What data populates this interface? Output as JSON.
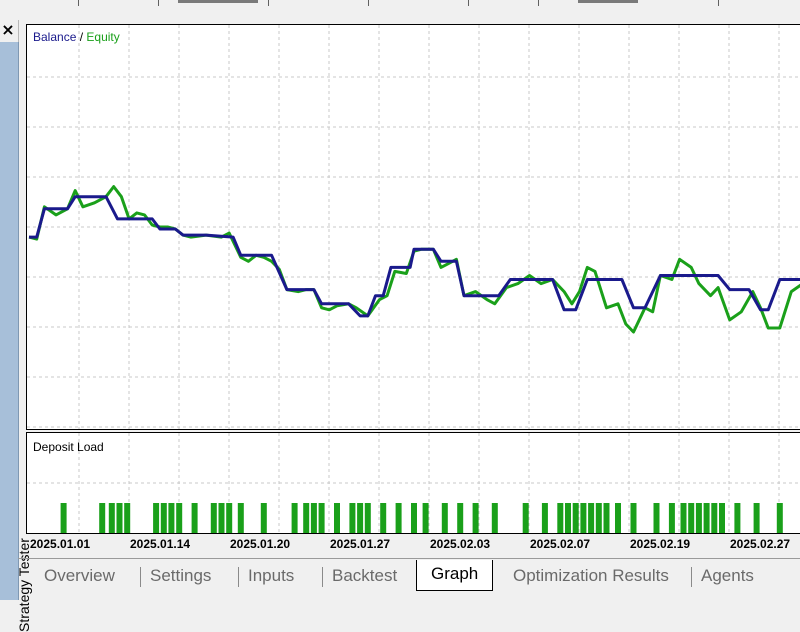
{
  "panel": {
    "title": "Strategy Tester",
    "close_glyph": "×",
    "close_icon": "close-icon"
  },
  "main_chart": {
    "legend_balance": "Balance",
    "legend_separator": "/",
    "legend_equity": "Equity"
  },
  "deposit_chart": {
    "label": "Deposit Load"
  },
  "tabs": [
    {
      "label": "Overview",
      "active": false
    },
    {
      "label": "Settings",
      "active": false
    },
    {
      "label": "Inputs",
      "active": false
    },
    {
      "label": "Backtest",
      "active": false
    },
    {
      "label": "Graph",
      "active": true
    },
    {
      "label": "Optimization Results",
      "active": false
    },
    {
      "label": "Agents",
      "active": false
    }
  ],
  "colors": {
    "balance": "#1a1a8c",
    "equity": "#1aa01a",
    "deposit_bar": "#1aa01a",
    "grid": "#c8c8c8"
  },
  "chart_data": {
    "type": "line",
    "title": "",
    "x_tick_labels": [
      "2025.01.01",
      "2025.01.14",
      "2025.01.20",
      "2025.01.27",
      "2025.02.03",
      "2025.02.07",
      "2025.02.19",
      "2025.02.27"
    ],
    "grid": true,
    "legend_placement": "top-left",
    "value_scale": "relative (no value axis labels shown); 0 = bottom, 1 = top of pane",
    "series": [
      {
        "name": "Balance",
        "points": [
          [
            0,
            0.475
          ],
          [
            0.02,
            0.475
          ],
          [
            0.04,
            0.545
          ],
          [
            0.1,
            0.545
          ],
          [
            0.12,
            0.575
          ],
          [
            0.2,
            0.575
          ],
          [
            0.23,
            0.52
          ],
          [
            0.32,
            0.52
          ],
          [
            0.34,
            0.495
          ],
          [
            0.38,
            0.495
          ],
          [
            0.4,
            0.48
          ],
          [
            0.46,
            0.48
          ],
          [
            0.53,
            0.475
          ],
          [
            0.55,
            0.43
          ],
          [
            0.63,
            0.43
          ],
          [
            0.67,
            0.345
          ],
          [
            0.74,
            0.345
          ],
          [
            0.76,
            0.31
          ],
          [
            0.83,
            0.31
          ],
          [
            0.86,
            0.28
          ],
          [
            0.88,
            0.28
          ],
          [
            0.9,
            0.33
          ],
          [
            0.92,
            0.33
          ],
          [
            0.94,
            0.4
          ],
          [
            0.99,
            0.4
          ],
          [
            1.0,
            0.445
          ],
          [
            1.05,
            0.445
          ],
          [
            1.07,
            0.415
          ],
          [
            1.11,
            0.415
          ],
          [
            1.13,
            0.33
          ],
          [
            1.22,
            0.33
          ],
          [
            1.25,
            0.37
          ],
          [
            1.36,
            0.37
          ],
          [
            1.39,
            0.295
          ],
          [
            1.42,
            0.295
          ],
          [
            1.45,
            0.37
          ],
          [
            1.54,
            0.37
          ],
          [
            1.57,
            0.3
          ],
          [
            1.6,
            0.3
          ],
          [
            1.64,
            0.38
          ],
          [
            1.79,
            0.38
          ],
          [
            1.82,
            0.345
          ],
          [
            1.87,
            0.345
          ],
          [
            1.9,
            0.295
          ],
          [
            1.92,
            0.295
          ],
          [
            1.95,
            0.37
          ],
          [
            2.05,
            0.37
          ],
          [
            2.1,
            0.295
          ],
          [
            2.16,
            0.295
          ],
          [
            2.2,
            0.235
          ],
          [
            2.26,
            0.235
          ],
          [
            2.3,
            0.405
          ],
          [
            2.35,
            0.405
          ],
          [
            2.38,
            0.345
          ],
          [
            2.44,
            0.345
          ],
          [
            2.47,
            0.325
          ],
          [
            2.52,
            0.325
          ],
          [
            2.55,
            0.36
          ],
          [
            2.6,
            0.36
          ],
          [
            2.62,
            0.31
          ]
        ],
        "x_units": "fraction of x-axis span between first label (0) and position ~2.6 at right edge"
      },
      {
        "name": "Equity",
        "points": [
          [
            0,
            0.475
          ],
          [
            0.02,
            0.47
          ],
          [
            0.04,
            0.55
          ],
          [
            0.07,
            0.53
          ],
          [
            0.1,
            0.545
          ],
          [
            0.12,
            0.59
          ],
          [
            0.14,
            0.55
          ],
          [
            0.17,
            0.56
          ],
          [
            0.2,
            0.575
          ],
          [
            0.22,
            0.6
          ],
          [
            0.24,
            0.575
          ],
          [
            0.26,
            0.52
          ],
          [
            0.28,
            0.535
          ],
          [
            0.3,
            0.53
          ],
          [
            0.32,
            0.505
          ],
          [
            0.34,
            0.5
          ],
          [
            0.36,
            0.5
          ],
          [
            0.38,
            0.495
          ],
          [
            0.4,
            0.48
          ],
          [
            0.42,
            0.475
          ],
          [
            0.46,
            0.48
          ],
          [
            0.5,
            0.475
          ],
          [
            0.52,
            0.485
          ],
          [
            0.55,
            0.425
          ],
          [
            0.57,
            0.415
          ],
          [
            0.59,
            0.43
          ],
          [
            0.61,
            0.425
          ],
          [
            0.63,
            0.415
          ],
          [
            0.65,
            0.395
          ],
          [
            0.67,
            0.345
          ],
          [
            0.7,
            0.34
          ],
          [
            0.72,
            0.345
          ],
          [
            0.74,
            0.345
          ],
          [
            0.76,
            0.3
          ],
          [
            0.78,
            0.295
          ],
          [
            0.8,
            0.305
          ],
          [
            0.83,
            0.31
          ],
          [
            0.85,
            0.3
          ],
          [
            0.88,
            0.28
          ],
          [
            0.91,
            0.32
          ],
          [
            0.93,
            0.33
          ],
          [
            0.95,
            0.39
          ],
          [
            0.98,
            0.385
          ],
          [
            1.0,
            0.44
          ],
          [
            1.02,
            0.445
          ],
          [
            1.05,
            0.445
          ],
          [
            1.07,
            0.4
          ],
          [
            1.09,
            0.41
          ],
          [
            1.11,
            0.42
          ],
          [
            1.13,
            0.33
          ],
          [
            1.16,
            0.34
          ],
          [
            1.19,
            0.32
          ],
          [
            1.21,
            0.31
          ],
          [
            1.24,
            0.35
          ],
          [
            1.27,
            0.36
          ],
          [
            1.3,
            0.38
          ],
          [
            1.33,
            0.36
          ],
          [
            1.36,
            0.37
          ],
          [
            1.39,
            0.34
          ],
          [
            1.41,
            0.31
          ],
          [
            1.43,
            0.34
          ],
          [
            1.45,
            0.4
          ],
          [
            1.47,
            0.39
          ],
          [
            1.5,
            0.3
          ],
          [
            1.53,
            0.31
          ],
          [
            1.55,
            0.26
          ],
          [
            1.57,
            0.24
          ],
          [
            1.6,
            0.3
          ],
          [
            1.62,
            0.29
          ],
          [
            1.64,
            0.38
          ],
          [
            1.67,
            0.37
          ],
          [
            1.69,
            0.42
          ],
          [
            1.72,
            0.4
          ],
          [
            1.74,
            0.36
          ],
          [
            1.77,
            0.33
          ],
          [
            1.79,
            0.35
          ],
          [
            1.82,
            0.27
          ],
          [
            1.85,
            0.29
          ],
          [
            1.88,
            0.34
          ],
          [
            1.9,
            0.3
          ],
          [
            1.92,
            0.25
          ],
          [
            1.95,
            0.25
          ],
          [
            1.98,
            0.34
          ],
          [
            2.01,
            0.36
          ],
          [
            2.04,
            0.38
          ],
          [
            2.07,
            0.35
          ],
          [
            2.1,
            0.3
          ],
          [
            2.13,
            0.28
          ],
          [
            2.16,
            0.28
          ],
          [
            2.18,
            0.39
          ],
          [
            2.21,
            0.38
          ],
          [
            2.24,
            0.33
          ],
          [
            2.27,
            0.36
          ],
          [
            2.3,
            0.405
          ],
          [
            2.32,
            0.41
          ],
          [
            2.35,
            0.41
          ],
          [
            2.38,
            0.36
          ],
          [
            2.41,
            0.35
          ],
          [
            2.44,
            0.35
          ],
          [
            2.47,
            0.31
          ],
          [
            2.5,
            0.28
          ],
          [
            2.53,
            0.35
          ],
          [
            2.55,
            0.38
          ],
          [
            2.57,
            0.36
          ],
          [
            2.6,
            0.4
          ],
          [
            2.62,
            0.31
          ]
        ]
      }
    ],
    "deposit_load": {
      "name": "Deposit Load",
      "bar_height_relative": 0.3,
      "bar_x_positions": [
        0.09,
        0.19,
        0.215,
        0.235,
        0.255,
        0.33,
        0.35,
        0.37,
        0.39,
        0.43,
        0.48,
        0.5,
        0.52,
        0.55,
        0.61,
        0.69,
        0.72,
        0.74,
        0.76,
        0.8,
        0.84,
        0.86,
        0.88,
        0.92,
        0.96,
        1.0,
        1.03,
        1.08,
        1.12,
        1.16,
        1.21,
        1.29,
        1.34,
        1.38,
        1.4,
        1.42,
        1.44,
        1.46,
        1.48,
        1.5,
        1.53,
        1.57,
        1.63,
        1.67,
        1.7,
        1.72,
        1.74,
        1.76,
        1.78,
        1.8,
        1.84,
        1.89,
        1.95,
        2.02,
        2.07,
        2.12,
        2.16,
        2.2,
        2.3,
        2.36,
        2.42,
        2.48,
        2.55
      ]
    }
  }
}
